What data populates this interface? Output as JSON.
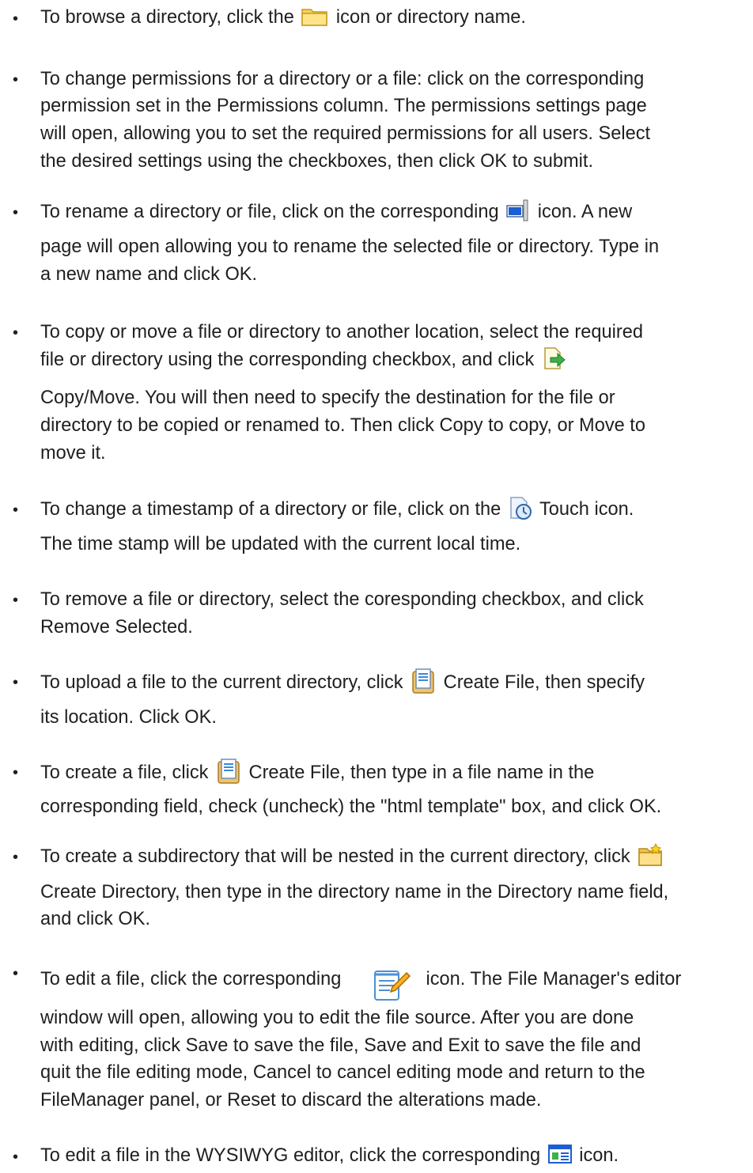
{
  "items": [
    {
      "lines": [
        "To browse a directory, click the ",
        " icon or directory name."
      ],
      "icon": "folder-icon"
    },
    {
      "lines": [
        "To change permissions for a directory or a file: click on the corresponding",
        "permission set in the Permissions column. The permissions settings page",
        "will open, allowing you to set the required permissions for all users. Select",
        "the desired settings using the checkboxes, then click OK to submit."
      ]
    },
    {
      "l1a": "To rename a directory or file, click on the corresponding ",
      "l1b": " icon. A new",
      "lines": [
        "page will open allowing you to rename the selected file or directory. Type in",
        "a new name and click OK."
      ],
      "icon": "rename-icon"
    },
    {
      "l1a": "To copy or move a file or directory to another location, select the required",
      "l2a": "file or directory using the corresponding checkbox, and click ",
      "lines": [
        "Copy/Move. You will then need to specify the destination for the file or",
        "directory to be copied or renamed to. Then click Copy to copy, or Move to",
        "move it."
      ],
      "icon": "copy-move-icon"
    },
    {
      "l1a": "To change a timestamp of a directory or file, click on the ",
      "l1b": " Touch icon.",
      "lines": [
        "The time stamp will be updated with the current local time."
      ],
      "icon": "touch-icon"
    },
    {
      "lines": [
        "To remove a file or directory, select the coresponding checkbox, and click",
        "Remove Selected."
      ]
    },
    {
      "l1a": "To upload a file to the current directory, click ",
      "l1b": " Create File, then specify",
      "lines": [
        "its location. Click OK."
      ],
      "icon": "create-file-icon"
    },
    {
      "l1a": "To create a file, click ",
      "l1b": " Create File, then type in a file name in the",
      "lines": [
        "corresponding field, check (uncheck) the \"html template\" box, and click OK."
      ],
      "icon": "create-file-icon"
    },
    {
      "l1a": "To create a subdirectory that will be nested in the current directory, click ",
      "lines": [
        "Create Directory, then type in the directory name in the Directory name field,",
        "and click OK."
      ],
      "icon": "create-directory-icon"
    },
    {
      "l1a": "To edit a file, click the corresponding ",
      "l1b": " icon. The File Manager's editor",
      "lines": [
        "window will open, allowing you to edit the file source. After you are done",
        "with editing, click Save to save the file, Save and Exit to save the file and",
        "quit the file editing mode, Cancel to cancel editing mode and return to the",
        "FileManager panel, or Reset to discard the alterations made."
      ],
      "icon": "edit-icon"
    },
    {
      "l1a": "To edit a file in the WYSIWYG editor, click the corresponding ",
      "l1b": " icon.",
      "icon": "wysiwyg-icon"
    }
  ],
  "bullet": "•"
}
